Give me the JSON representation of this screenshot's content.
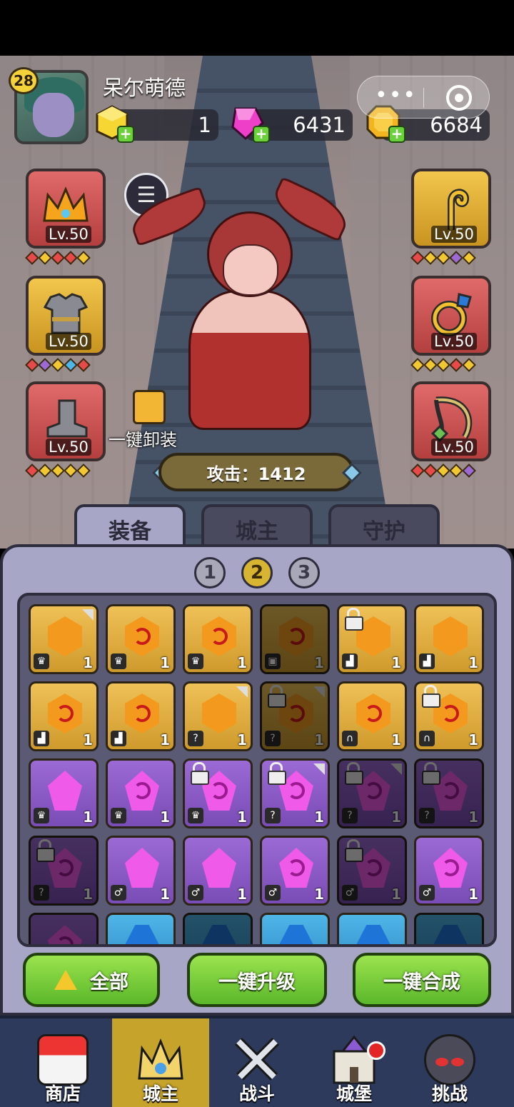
{
  "player": {
    "name": "呆尔萌德",
    "level": "28"
  },
  "resources": [
    {
      "name": "gold-cube",
      "value": "1"
    },
    {
      "name": "pink-gem",
      "value": "6431"
    },
    {
      "name": "gold-coin",
      "value": "6684"
    }
  ],
  "equipment": {
    "left": [
      {
        "slot": "crown",
        "level": "Lv.50",
        "gems": [
          "#e84a4a",
          "#f2c832",
          "#e84a4a",
          "#e84a4a",
          "#f2c832"
        ]
      },
      {
        "slot": "armor",
        "level": "Lv.50",
        "gems": [
          "#e84a4a",
          "#9b6ad4",
          "#f2c832",
          "#4fb6e8",
          "#e84a4a"
        ]
      },
      {
        "slot": "boots",
        "level": "Lv.50",
        "gems": [
          "#e84a4a",
          "#f2c832",
          "#f2c832",
          "#f2c832",
          "#f2c832"
        ]
      }
    ],
    "right": [
      {
        "slot": "staff",
        "level": "Lv.50",
        "gems": [
          "#e84a4a",
          "#f2c832",
          "#f2c832",
          "#9b6ad4",
          "#f2c832"
        ]
      },
      {
        "slot": "ring",
        "level": "Lv.50",
        "gems": [
          "#f2c832",
          "#f2c832",
          "#f2c832",
          "#e84a4a",
          "#f2c832"
        ]
      },
      {
        "slot": "necklace",
        "level": "Lv.50",
        "gems": [
          "#e84a4a",
          "#e84a4a",
          "#f2c832",
          "#f2c832",
          "#9b6ad4"
        ]
      }
    ]
  },
  "unequip_label": "一键卸装",
  "attack_label": "攻击：1412",
  "tabs": [
    "装备",
    "城主",
    "守护"
  ],
  "pages": [
    "1",
    "2",
    "3"
  ],
  "inventory": [
    {
      "color": "gold",
      "spiral": false,
      "type": "crown",
      "count": "1",
      "lock": false,
      "corner": true,
      "dim": false
    },
    {
      "color": "gold",
      "spiral": true,
      "type": "crown",
      "count": "1",
      "lock": false,
      "corner": false,
      "dim": false
    },
    {
      "color": "gold",
      "spiral": true,
      "type": "crown",
      "count": "1",
      "lock": false,
      "corner": false,
      "dim": false
    },
    {
      "color": "gold",
      "spiral": true,
      "type": "armor",
      "count": "1",
      "lock": false,
      "corner": false,
      "dim": true
    },
    {
      "color": "gold",
      "spiral": false,
      "type": "boots",
      "count": "1",
      "lock": true,
      "corner": false,
      "dim": false
    },
    {
      "color": "gold",
      "spiral": false,
      "type": "boots",
      "count": "1",
      "lock": false,
      "corner": false,
      "dim": false
    },
    {
      "color": "gold",
      "spiral": true,
      "type": "boots",
      "count": "1",
      "lock": false,
      "corner": false,
      "dim": false
    },
    {
      "color": "gold",
      "spiral": true,
      "type": "boots",
      "count": "1",
      "lock": false,
      "corner": false,
      "dim": false
    },
    {
      "color": "gold",
      "spiral": false,
      "type": "staff",
      "count": "1",
      "lock": false,
      "corner": true,
      "dim": false
    },
    {
      "color": "gold",
      "spiral": true,
      "type": "staff",
      "count": "1",
      "lock": true,
      "corner": true,
      "dim": true
    },
    {
      "color": "gold",
      "spiral": true,
      "type": "necklace",
      "count": "1",
      "lock": false,
      "corner": false,
      "dim": false
    },
    {
      "color": "gold",
      "spiral": true,
      "type": "necklace",
      "count": "1",
      "lock": true,
      "corner": false,
      "dim": false
    },
    {
      "color": "purple",
      "spiral": false,
      "type": "crown",
      "count": "1",
      "lock": false,
      "corner": false,
      "dim": false
    },
    {
      "color": "purple",
      "spiral": true,
      "type": "crown",
      "count": "1",
      "lock": false,
      "corner": false,
      "dim": false
    },
    {
      "color": "purple",
      "spiral": true,
      "type": "crown",
      "count": "1",
      "lock": true,
      "corner": false,
      "dim": false
    },
    {
      "color": "purple",
      "spiral": true,
      "type": "staff",
      "count": "1",
      "lock": true,
      "corner": true,
      "dim": false
    },
    {
      "color": "purple",
      "spiral": true,
      "type": "staff",
      "count": "1",
      "lock": true,
      "corner": true,
      "dim": true
    },
    {
      "color": "purple",
      "spiral": true,
      "type": "staff",
      "count": "1",
      "lock": true,
      "corner": false,
      "dim": true
    },
    {
      "color": "purple",
      "spiral": true,
      "type": "staff",
      "count": "1",
      "lock": true,
      "corner": false,
      "dim": true
    },
    {
      "color": "purple",
      "spiral": false,
      "type": "ring",
      "count": "1",
      "lock": false,
      "corner": false,
      "dim": false
    },
    {
      "color": "purple",
      "spiral": false,
      "type": "ring",
      "count": "1",
      "lock": false,
      "corner": false,
      "dim": false
    },
    {
      "color": "purple",
      "spiral": true,
      "type": "ring",
      "count": "1",
      "lock": false,
      "corner": false,
      "dim": false
    },
    {
      "color": "purple",
      "spiral": true,
      "type": "ring",
      "count": "1",
      "lock": true,
      "corner": false,
      "dim": true
    },
    {
      "color": "purple",
      "spiral": true,
      "type": "ring",
      "count": "1",
      "lock": false,
      "corner": false,
      "dim": false
    },
    {
      "color": "purple",
      "spiral": true,
      "type": "",
      "count": "",
      "lock": false,
      "corner": false,
      "dim": true
    },
    {
      "color": "blue",
      "spiral": false,
      "type": "",
      "count": "",
      "lock": false,
      "corner": false,
      "dim": false
    },
    {
      "color": "blue",
      "spiral": false,
      "type": "",
      "count": "",
      "lock": false,
      "corner": false,
      "dim": true
    },
    {
      "color": "blue",
      "spiral": false,
      "type": "",
      "count": "",
      "lock": false,
      "corner": false,
      "dim": false
    },
    {
      "color": "blue",
      "spiral": false,
      "type": "",
      "count": "",
      "lock": false,
      "corner": false,
      "dim": false
    },
    {
      "color": "blue",
      "spiral": false,
      "type": "",
      "count": "",
      "lock": false,
      "corner": false,
      "dim": true
    }
  ],
  "actions": {
    "all": "全部",
    "upgrade": "一键升级",
    "combine": "一键合成"
  },
  "nav": [
    {
      "label": "商店",
      "active": false,
      "dot": false
    },
    {
      "label": "城主",
      "active": true,
      "dot": false
    },
    {
      "label": "战斗",
      "active": false,
      "dot": false
    },
    {
      "label": "城堡",
      "active": false,
      "dot": true
    },
    {
      "label": "挑战",
      "active": false,
      "dot": false
    }
  ]
}
